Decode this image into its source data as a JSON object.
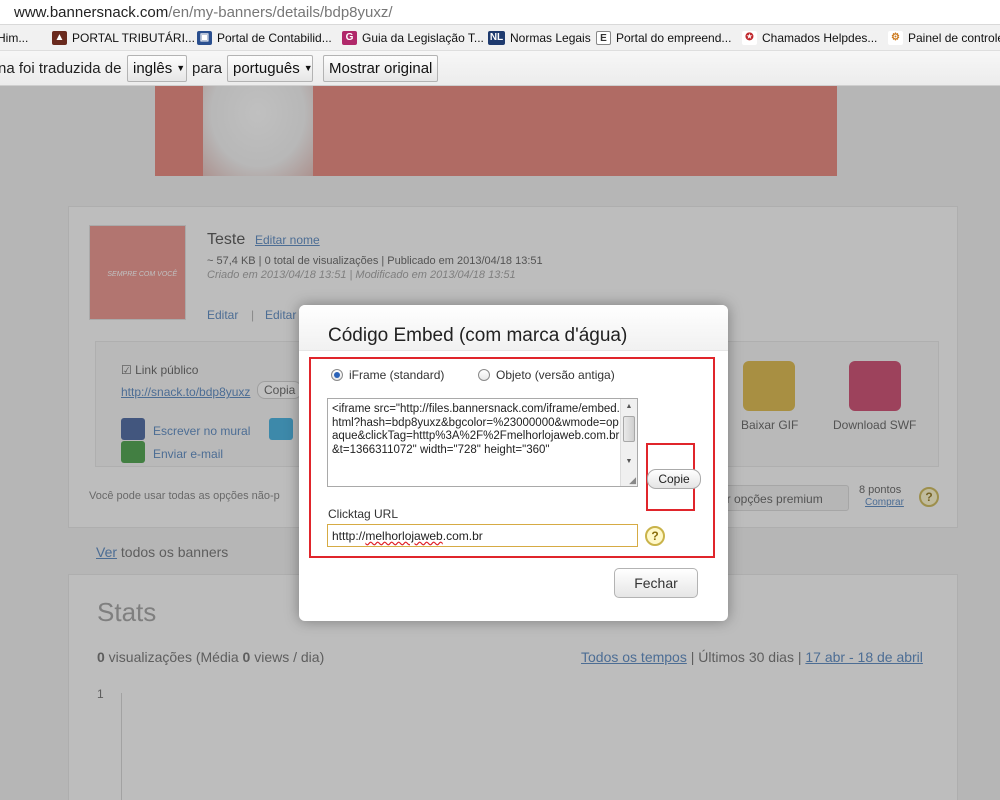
{
  "browser": {
    "url_host": "www.bannersnack.com",
    "url_path": "/en/my-banners/details/bdp8yuxz/",
    "bookmarks": [
      {
        "label": "Him...",
        "icon": "folder-icon",
        "color": "#999999"
      },
      {
        "label": "PORTAL TRIBUTÁRI...",
        "icon": "portal-tributario-icon",
        "color": "#6a2a1e"
      },
      {
        "label": "Portal de Contabilid...",
        "icon": "portal-contabilidade-icon",
        "color": "#2a4f8f"
      },
      {
        "label": "Guia da Legislação T...",
        "icon": "guia-legislacao-icon",
        "color": "#b0286a"
      },
      {
        "label": "Normas Legais",
        "icon": "normas-legais-icon",
        "color": "#1e3a6e"
      },
      {
        "label": "Portal do empreend...",
        "icon": "portal-empreendedor-icon",
        "color": "#333333"
      },
      {
        "label": "Chamados Helpdes...",
        "icon": "helpdesk-icon",
        "color": "#c0282d"
      },
      {
        "label": "Painel de controle",
        "icon": "painel-controle-icon",
        "color": "#cc7a1f"
      }
    ],
    "translate_bar": {
      "prefix": "na foi traduzida de",
      "from_lang": "inglês",
      "connector": "para",
      "to_lang": "português",
      "show_original": "Mostrar original"
    }
  },
  "page": {
    "banner_caption": "SEMPRE\nCOM VOCÊ",
    "banner_name": "Teste",
    "edit_name": "Editar nome",
    "meta_line": "~ 57,4 KB | 0 total de visualizações | Publicado em 2013/04/18 13:51",
    "meta_line_2": "Criado em 2013/04/18 13:51 | Modificado em 2013/04/18 13:51",
    "edit": "Editar",
    "edit2": "Editar",
    "public_link_label": "Link público",
    "public_link": "http://snack.to/bdp8yuxz",
    "copy_small": "Copia",
    "write_wall": "Escrever no mural",
    "send_email": "Enviar e-mail",
    "download_gif": "Baixar GIF",
    "download_swf": "Download SWF",
    "notice": "Você pode usar todas as opções não-p",
    "premium_btn": "ar opções premium",
    "points": "8 pontos",
    "buy": "Comprar",
    "see_all_link": "Ver",
    "see_all_rest": " todos os banners",
    "stats_title": "Stats",
    "stats_views": "0",
    "stats_views_label": " visualizações (Média ",
    "stats_avg": "0",
    "stats_avg_label": " views / dia)",
    "range_all": "Todos os tempos",
    "range_sep": " | Últimos 30 dias | ",
    "range_dates": "17 abr - 18 de abril",
    "axis_one": "1"
  },
  "modal": {
    "title": "Código Embed (com marca d'água)",
    "radio_iframe": "iFrame (standard)",
    "radio_object": "Objeto (versão antiga)",
    "selected": "iframe",
    "code": "<iframe src=\"http://files.bannersnack.com/iframe/embed.html?hash=bdp8yuxz&bgcolor=%23000000&wmode=opaque&clickTag=htttp%3A%2F%2Fmelhorlojaweb.com.br&t=1366311072\" width=\"728\" height=\"360\"",
    "copy_button": "Copie",
    "clicktag_label": "Clicktag URL",
    "clicktag_value_start": "htttp://",
    "clicktag_value_underlined": "melhorlojaweb",
    "clicktag_value_end": ".com.br",
    "help": "?",
    "close_button": "Fechar",
    "highlight_color": "#e0252b"
  }
}
